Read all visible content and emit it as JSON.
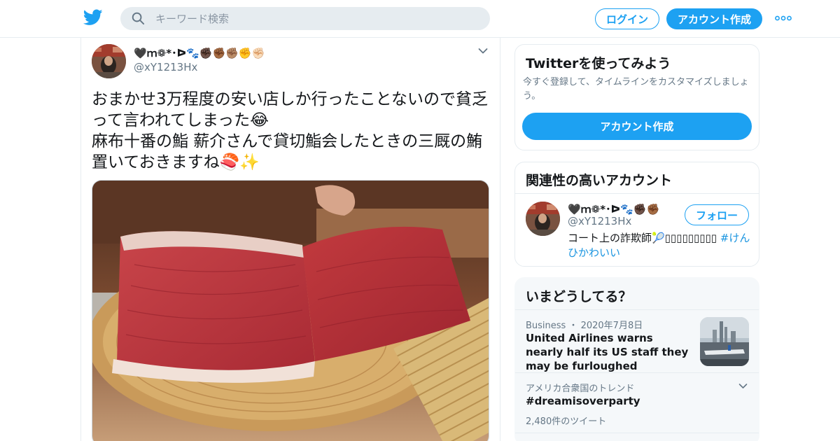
{
  "header": {
    "search_placeholder": "キーワード検索",
    "login_label": "ログイン",
    "signup_label": "アカウント作成",
    "accent_color": "#1da1f2"
  },
  "tweet": {
    "display_name": "🖤ｍ❁*･ᐅ🐾✊🏿✊🏾✊🏽✊✊🏻",
    "handle": "@xY1213Hx",
    "text": "おまかせ3万程度の安い店しか行ったことないので貧乏って言われてしまった😂\n麻布十番の鮨 薪介さんで貸切鮨会したときの三厩の鮪置いておきますね🍣✨",
    "media_icon": "tuna-photo"
  },
  "sidebar": {
    "try_card": {
      "title": "Twitterを使ってみよう",
      "desc": "今すぐ登録して、タイムラインをカスタマイズしましょう。",
      "button": "アカウント作成"
    },
    "related": {
      "title": "関連性の高いアカウント",
      "name": "🖤ｍ❁*･ᐅ🐾✊🏿✊🏾",
      "handle": "@xY1213Hx",
      "follow_label": "フォロー",
      "bio_text": "コート上の詐欺師🎾▯▯▯▯▯▯▯▯▯ ",
      "bio_tag": "#けんひかわいい"
    },
    "trends": {
      "title": "いまどうしてる？",
      "items": [
        {
          "meta": "Business ・ 2020年7月8日",
          "headline": "United Airlines warns nearly half its US staff they may be furloughed"
        },
        {
          "meta": "アメリカ合衆国のトレンド",
          "headline": "#dreamisoverparty",
          "count": "2,480件のツイート"
        }
      ]
    }
  }
}
